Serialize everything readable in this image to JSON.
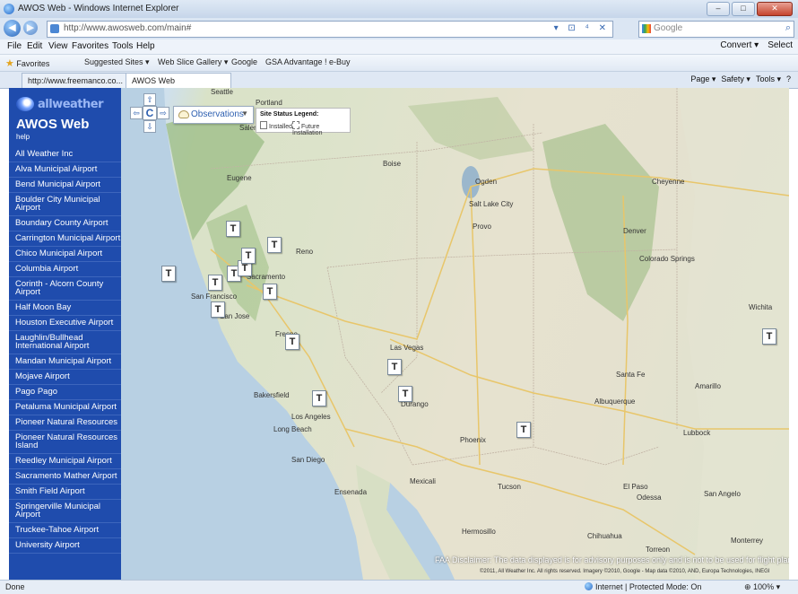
{
  "window": {
    "title": "AWOS Web - Windows Internet Explorer",
    "controls": [
      "–",
      "□",
      "✕"
    ]
  },
  "address_bar": {
    "url": "http://www.awosweb.com/main#",
    "tool_glyphs": "▾ ⊡ ⁴ ✕",
    "search_placeholder": "Google"
  },
  "menu": {
    "items": [
      "File",
      "Edit",
      "View",
      "Favorites",
      "Tools",
      "Help"
    ],
    "right": [
      "Convert ▾",
      "Select"
    ]
  },
  "favorites_bar": {
    "favorites": "Favorites",
    "items": [
      "Suggested Sites ▾",
      "Web Slice Gallery ▾",
      "Google",
      "GSA Advantage ! e-Buy"
    ]
  },
  "tabs": [
    {
      "label": "http://www.freemanco.co..."
    },
    {
      "label": "AWOS Web"
    }
  ],
  "command_bar": [
    "Page ▾",
    "Safety ▾",
    "Tools ▾",
    "?"
  ],
  "sidebar": {
    "logo_text": "allweather",
    "app_name": "AWOS Web",
    "help": "help",
    "sites": [
      "All Weather Inc",
      "Alva Municipal Airport",
      "Bend Municipal Airport",
      "Boulder City Municipal Airport",
      "Boundary County Airport",
      "Carrington Municipal Airport",
      "Chico Municipal Airport",
      "Columbia Airport",
      "Corinth - Alcorn County Airport",
      "Half Moon Bay",
      "Houston Executive Airport",
      "Laughlin/Bullhead International Airport",
      "Mandan Municipal Airport",
      "Mojave Airport",
      "Pago Pago",
      "Petaluma Municipal Airport",
      "Pioneer Natural Resources",
      "Pioneer Natural Resources Island",
      "Reedley Municipal Airport",
      "Sacramento Mather Airport",
      "Smith Field Airport",
      "Springerville Municipal Airport",
      "Truckee-Tahoe Airport",
      "University Airport"
    ]
  },
  "map_controls": {
    "pan_up": "⇧",
    "pan_left": "⇦",
    "pan_center": "C",
    "pan_right": "⇨",
    "pan_down": "⇩",
    "observations_label": "Observations",
    "legend_title": "Site Status Legend:",
    "legend_installed": "Installed",
    "legend_future": "Future Installation"
  },
  "cities": [
    "Portland",
    "Salem",
    "Boise",
    "Eugene",
    "Seattle",
    "Cheyenne",
    "Ogden",
    "Salt Lake City",
    "Provo",
    "Denver",
    "Colorado Springs",
    "Reno",
    "Sacramento",
    "San Francisco",
    "San Jose",
    "Fresno",
    "Bakersfield",
    "Las Vegas",
    "Los Angeles",
    "Long Beach",
    "San Diego",
    "Phoenix",
    "Tucson",
    "Albuquerque",
    "Santa Fe",
    "Mexicali",
    "Ensenada",
    "Lubbock",
    "Amarillo",
    "Wichita",
    "El Paso",
    "Durango",
    "Odessa",
    "San Angelo",
    "Chihuahua",
    "Hermosillo",
    "Torreon",
    "Monterrey"
  ],
  "tower_label": "T",
  "disclaimer": "FAA Disclaimer: The data displayed is for advisory purposes only and is not to be used for flight planning or operation.",
  "copyright": "©2011, All Weather Inc. All rights reserved. Imagery ©2010, Google - Map data ©2010, AND, Europa Technologies, INEGI",
  "status": {
    "left": "Done",
    "zone": "Internet | Protected Mode: On",
    "zoom": "100%"
  }
}
